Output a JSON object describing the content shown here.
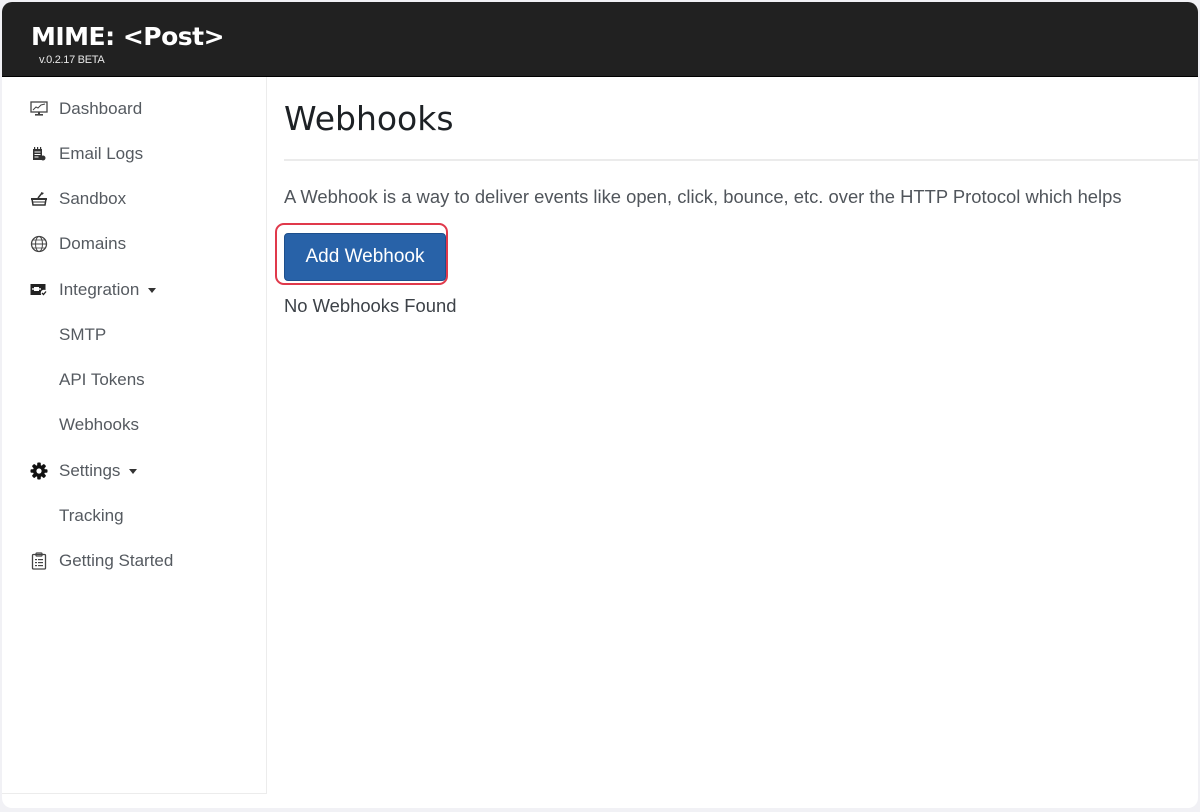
{
  "app": {
    "brand": "MIME: <Post>",
    "version": "v.0.2.17 BETA"
  },
  "sidebar": {
    "items": [
      {
        "label": "Dashboard",
        "icon": "dashboard-chart-icon"
      },
      {
        "label": "Email Logs",
        "icon": "email-logs-icon"
      },
      {
        "label": "Sandbox",
        "icon": "sandbox-icon"
      },
      {
        "label": "Domains",
        "icon": "globe-icon"
      },
      {
        "label": "Integration",
        "icon": "integration-icon",
        "expandable": true
      },
      {
        "label": "SMTP",
        "sub": true
      },
      {
        "label": "API Tokens",
        "sub": true
      },
      {
        "label": "Webhooks",
        "sub": true
      },
      {
        "label": "Settings",
        "icon": "gear-icon",
        "expandable": true
      },
      {
        "label": "Tracking",
        "sub": true
      },
      {
        "label": "Getting Started",
        "icon": "clipboard-icon"
      }
    ]
  },
  "main": {
    "title": "Webhooks",
    "description": "A Webhook is a way to deliver events like open, click, bounce, etc. over the HTTP Protocol which helps",
    "add_button_label": "Add Webhook",
    "empty_message": "No Webhooks Found"
  },
  "colors": {
    "topbar": "#212121",
    "primary": "#2862a8",
    "highlight": "#e0394b"
  }
}
